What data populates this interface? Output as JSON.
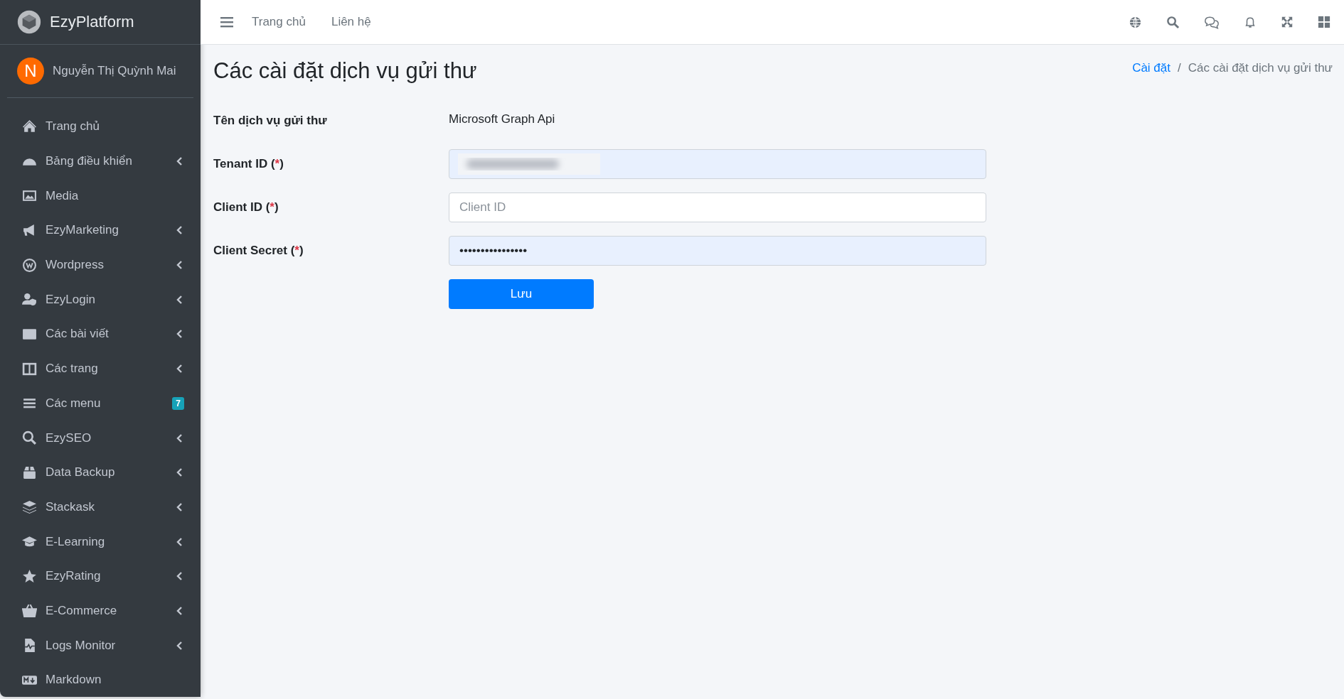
{
  "brand": {
    "name": "EzyPlatform"
  },
  "user": {
    "initial": "N",
    "name": "Nguyễn Thị Quỳnh Mai"
  },
  "sidebar": {
    "items": [
      {
        "label": "Trang chủ",
        "has_submenu": false
      },
      {
        "label": "Bảng điều khiển",
        "has_submenu": true
      },
      {
        "label": "Media",
        "has_submenu": false
      },
      {
        "label": "EzyMarketing",
        "has_submenu": true
      },
      {
        "label": "Wordpress",
        "has_submenu": true
      },
      {
        "label": "EzyLogin",
        "has_submenu": true
      },
      {
        "label": "Các bài viết",
        "has_submenu": true
      },
      {
        "label": "Các trang",
        "has_submenu": true
      },
      {
        "label": "Các menu",
        "has_submenu": false,
        "badge": "7"
      },
      {
        "label": "EzySEO",
        "has_submenu": true
      },
      {
        "label": "Data Backup",
        "has_submenu": true
      },
      {
        "label": "Stackask",
        "has_submenu": true
      },
      {
        "label": "E-Learning",
        "has_submenu": true
      },
      {
        "label": "EzyRating",
        "has_submenu": true
      },
      {
        "label": "E-Commerce",
        "has_submenu": true
      },
      {
        "label": "Logs Monitor",
        "has_submenu": true
      },
      {
        "label": "Markdown",
        "has_submenu": false
      }
    ]
  },
  "topbar": {
    "links": [
      "Trang chủ",
      "Liên hệ"
    ]
  },
  "page": {
    "title": "Các cài đặt dịch vụ gửi thư",
    "breadcrumb_separator": "/",
    "breadcrumb": [
      {
        "label": "Cài đặt",
        "kind": "link"
      },
      {
        "label": "Các cài đặt dịch vụ gửi thư",
        "kind": "current"
      }
    ]
  },
  "form": {
    "rows": [
      {
        "kind": "static",
        "label": "Tên dịch vụ gửi thư",
        "value": "Microsoft Graph Api"
      },
      {
        "kind": "input",
        "label": "Tenant ID (",
        "required_sign": "*",
        "label_end": ")",
        "redacted": true,
        "autofilled": true
      },
      {
        "kind": "input",
        "label": "Client ID (",
        "required_sign": "*",
        "label_end": ")",
        "placeholder": "Client ID",
        "autofilled": false
      },
      {
        "kind": "input",
        "label": "Client Secret (",
        "required_sign": "*",
        "label_end": ")",
        "value": "••••••••••••••••",
        "autofilled": true
      }
    ],
    "submit": "Lưu"
  }
}
